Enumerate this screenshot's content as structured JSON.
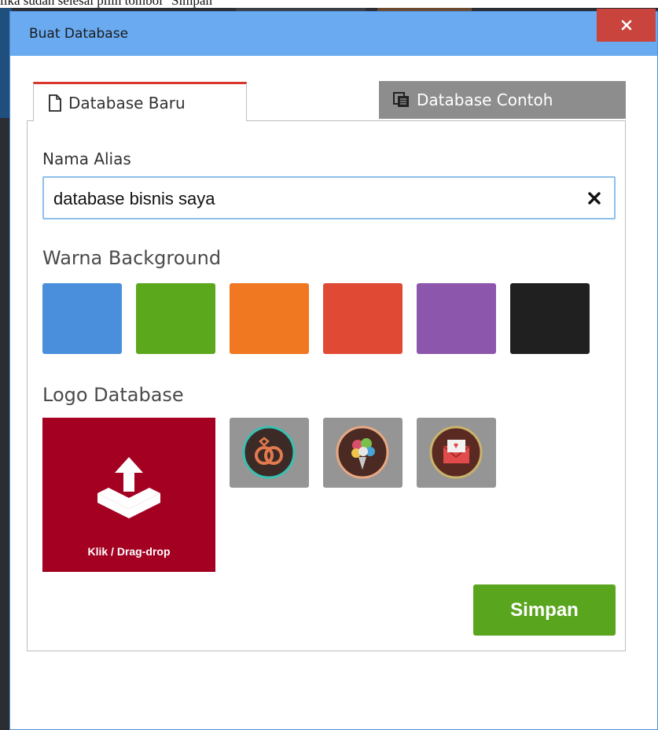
{
  "caption": "lika sudah selesai pilih tombol \"Simpan\"",
  "dialog": {
    "title": "Buat Database",
    "close_icon": "close-icon"
  },
  "tabs": [
    {
      "label": "Database Baru",
      "icon": "document-icon",
      "active": true
    },
    {
      "label": "Database Contoh",
      "icon": "copy-icon",
      "active": false
    }
  ],
  "form": {
    "alias_label": "Nama Alias",
    "alias_value": "database bisnis saya",
    "background_label": "Warna Background",
    "colors": [
      "#4a8fdc",
      "#5ca81d",
      "#f07820",
      "#e04a34",
      "#8d56ad",
      "#202020"
    ],
    "logo_label": "Logo Database",
    "upload_label": "Klik / Drag-drop",
    "logo_options": [
      "rings-icon",
      "flower-bouquet-icon",
      "envelope-icon"
    ],
    "save_label": "Simpan"
  },
  "accent": {
    "titlebar": "#6aaaf0",
    "upload": "#a30022",
    "save": "#5aa51e"
  }
}
